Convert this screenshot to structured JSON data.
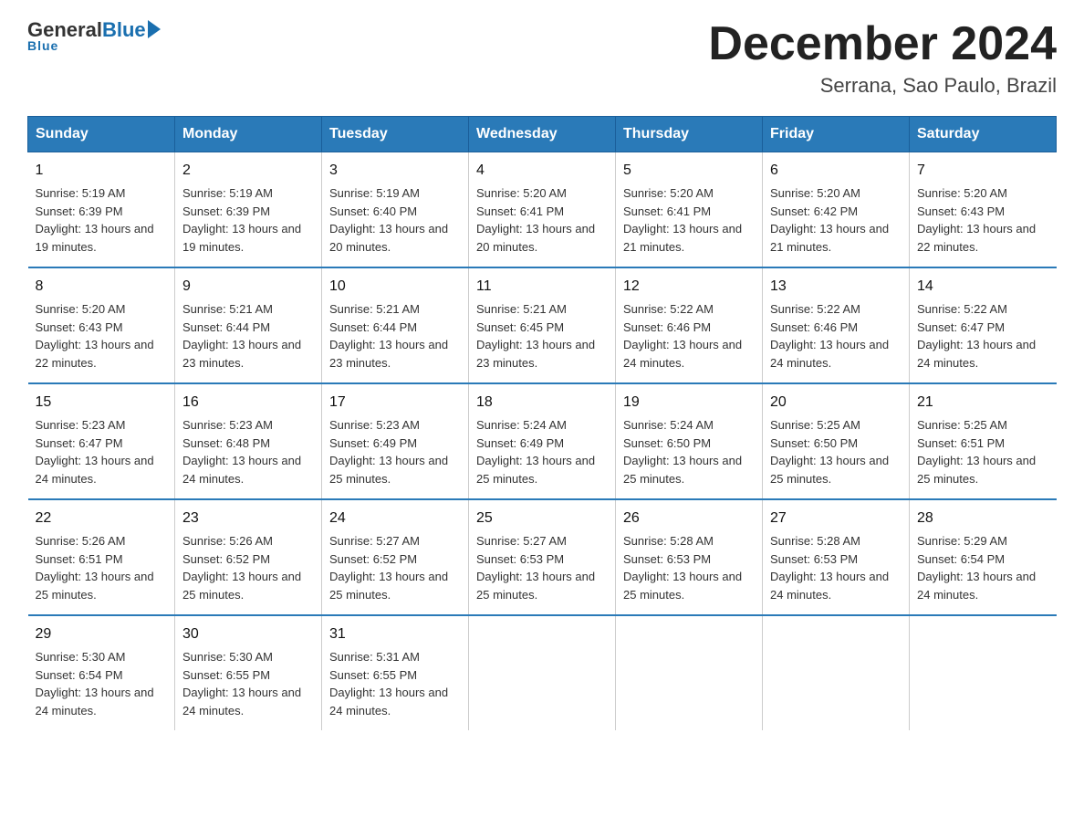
{
  "logo": {
    "general": "General",
    "blue": "Blue",
    "underline": "Blue"
  },
  "header": {
    "month_title": "December 2024",
    "subtitle": "Serrana, Sao Paulo, Brazil"
  },
  "days_of_week": [
    "Sunday",
    "Monday",
    "Tuesday",
    "Wednesday",
    "Thursday",
    "Friday",
    "Saturday"
  ],
  "weeks": [
    [
      {
        "num": "1",
        "sunrise": "5:19 AM",
        "sunset": "6:39 PM",
        "daylight": "13 hours and 19 minutes."
      },
      {
        "num": "2",
        "sunrise": "5:19 AM",
        "sunset": "6:39 PM",
        "daylight": "13 hours and 19 minutes."
      },
      {
        "num": "3",
        "sunrise": "5:19 AM",
        "sunset": "6:40 PM",
        "daylight": "13 hours and 20 minutes."
      },
      {
        "num": "4",
        "sunrise": "5:20 AM",
        "sunset": "6:41 PM",
        "daylight": "13 hours and 20 minutes."
      },
      {
        "num": "5",
        "sunrise": "5:20 AM",
        "sunset": "6:41 PM",
        "daylight": "13 hours and 21 minutes."
      },
      {
        "num": "6",
        "sunrise": "5:20 AM",
        "sunset": "6:42 PM",
        "daylight": "13 hours and 21 minutes."
      },
      {
        "num": "7",
        "sunrise": "5:20 AM",
        "sunset": "6:43 PM",
        "daylight": "13 hours and 22 minutes."
      }
    ],
    [
      {
        "num": "8",
        "sunrise": "5:20 AM",
        "sunset": "6:43 PM",
        "daylight": "13 hours and 22 minutes."
      },
      {
        "num": "9",
        "sunrise": "5:21 AM",
        "sunset": "6:44 PM",
        "daylight": "13 hours and 23 minutes."
      },
      {
        "num": "10",
        "sunrise": "5:21 AM",
        "sunset": "6:44 PM",
        "daylight": "13 hours and 23 minutes."
      },
      {
        "num": "11",
        "sunrise": "5:21 AM",
        "sunset": "6:45 PM",
        "daylight": "13 hours and 23 minutes."
      },
      {
        "num": "12",
        "sunrise": "5:22 AM",
        "sunset": "6:46 PM",
        "daylight": "13 hours and 24 minutes."
      },
      {
        "num": "13",
        "sunrise": "5:22 AM",
        "sunset": "6:46 PM",
        "daylight": "13 hours and 24 minutes."
      },
      {
        "num": "14",
        "sunrise": "5:22 AM",
        "sunset": "6:47 PM",
        "daylight": "13 hours and 24 minutes."
      }
    ],
    [
      {
        "num": "15",
        "sunrise": "5:23 AM",
        "sunset": "6:47 PM",
        "daylight": "13 hours and 24 minutes."
      },
      {
        "num": "16",
        "sunrise": "5:23 AM",
        "sunset": "6:48 PM",
        "daylight": "13 hours and 24 minutes."
      },
      {
        "num": "17",
        "sunrise": "5:23 AM",
        "sunset": "6:49 PM",
        "daylight": "13 hours and 25 minutes."
      },
      {
        "num": "18",
        "sunrise": "5:24 AM",
        "sunset": "6:49 PM",
        "daylight": "13 hours and 25 minutes."
      },
      {
        "num": "19",
        "sunrise": "5:24 AM",
        "sunset": "6:50 PM",
        "daylight": "13 hours and 25 minutes."
      },
      {
        "num": "20",
        "sunrise": "5:25 AM",
        "sunset": "6:50 PM",
        "daylight": "13 hours and 25 minutes."
      },
      {
        "num": "21",
        "sunrise": "5:25 AM",
        "sunset": "6:51 PM",
        "daylight": "13 hours and 25 minutes."
      }
    ],
    [
      {
        "num": "22",
        "sunrise": "5:26 AM",
        "sunset": "6:51 PM",
        "daylight": "13 hours and 25 minutes."
      },
      {
        "num": "23",
        "sunrise": "5:26 AM",
        "sunset": "6:52 PM",
        "daylight": "13 hours and 25 minutes."
      },
      {
        "num": "24",
        "sunrise": "5:27 AM",
        "sunset": "6:52 PM",
        "daylight": "13 hours and 25 minutes."
      },
      {
        "num": "25",
        "sunrise": "5:27 AM",
        "sunset": "6:53 PM",
        "daylight": "13 hours and 25 minutes."
      },
      {
        "num": "26",
        "sunrise": "5:28 AM",
        "sunset": "6:53 PM",
        "daylight": "13 hours and 25 minutes."
      },
      {
        "num": "27",
        "sunrise": "5:28 AM",
        "sunset": "6:53 PM",
        "daylight": "13 hours and 24 minutes."
      },
      {
        "num": "28",
        "sunrise": "5:29 AM",
        "sunset": "6:54 PM",
        "daylight": "13 hours and 24 minutes."
      }
    ],
    [
      {
        "num": "29",
        "sunrise": "5:30 AM",
        "sunset": "6:54 PM",
        "daylight": "13 hours and 24 minutes."
      },
      {
        "num": "30",
        "sunrise": "5:30 AM",
        "sunset": "6:55 PM",
        "daylight": "13 hours and 24 minutes."
      },
      {
        "num": "31",
        "sunrise": "5:31 AM",
        "sunset": "6:55 PM",
        "daylight": "13 hours and 24 minutes."
      },
      {
        "num": "",
        "sunrise": "",
        "sunset": "",
        "daylight": ""
      },
      {
        "num": "",
        "sunrise": "",
        "sunset": "",
        "daylight": ""
      },
      {
        "num": "",
        "sunrise": "",
        "sunset": "",
        "daylight": ""
      },
      {
        "num": "",
        "sunrise": "",
        "sunset": "",
        "daylight": ""
      }
    ]
  ]
}
